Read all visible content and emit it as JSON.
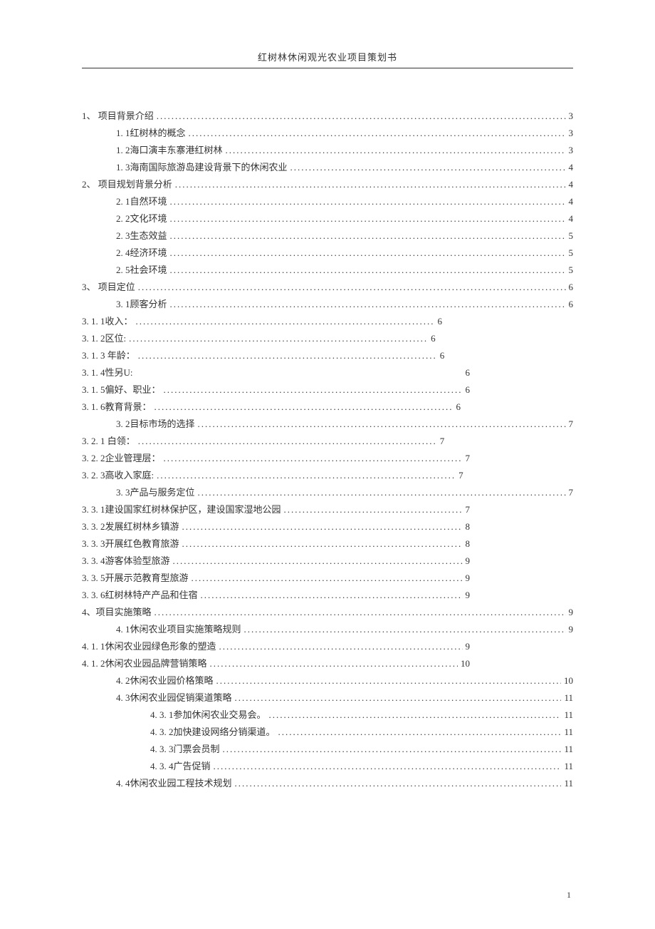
{
  "header": "红树林休闲观光农业项目策划书",
  "page_number": "1",
  "toc": [
    {
      "label": "1、  项目背景介绍",
      "page": "3",
      "indent": 0,
      "style": "full"
    },
    {
      "label": "1. 1红树林的概念",
      "page": "3",
      "indent": 1,
      "style": "full"
    },
    {
      "label": "1. 2海口演丰东寨港红树林  ",
      "page": " 3",
      "indent": 1,
      "style": "full"
    },
    {
      "label": "1. 3海南国际旅游岛建设背景下的休闲农业  ",
      "page": "4",
      "indent": 1,
      "style": "full"
    },
    {
      "label": "2、  项目规划背景分析  ",
      "page": "4",
      "indent": 0,
      "style": "full"
    },
    {
      "label": "2. 1自然环境 ",
      "page": "4",
      "indent": 1,
      "style": "full"
    },
    {
      "label": "2. 2文化环境 ",
      "page": "4",
      "indent": 1,
      "style": "full"
    },
    {
      "label": "2. 3生态效益 ",
      "page": "5",
      "indent": 1,
      "style": "full"
    },
    {
      "label": "2. 4经济环境 ",
      "page": "5",
      "indent": 1,
      "style": "full"
    },
    {
      "label": "2. 5社会环境 ",
      "page": "5",
      "indent": 1,
      "style": "full"
    },
    {
      "label": "3、  项目定位 ",
      "page": "6",
      "indent": 0,
      "style": "full"
    },
    {
      "label": "3. 1顾客分析 ",
      "page": "6",
      "indent": 1,
      "style": "full"
    },
    {
      "label": "3. 1. 1收入：",
      "page": "6",
      "indent": 0,
      "style": "short"
    },
    {
      "label": "3. 1. 2区位:",
      "page": "6",
      "indent": 0,
      "style": "short"
    },
    {
      "label": "3. 1. 3 年龄：",
      "page": "6",
      "indent": 0,
      "style": "short"
    },
    {
      "label": "3. 1. 4性另U:",
      "page": "6",
      "indent": 0,
      "style": "nodots"
    },
    {
      "label": "3. 1. 5偏好、职业：",
      "page": "6",
      "indent": 0,
      "style": "short"
    },
    {
      "label": "3. 1. 6教育背景：  ",
      "page": "6",
      "indent": 0,
      "style": "short"
    },
    {
      "label": "3. 2目标市场的选择 ",
      "page": "7",
      "indent": 1,
      "style": "full"
    },
    {
      "label": "3. 2. 1  白领：",
      "page": "7",
      "indent": 0,
      "style": "short"
    },
    {
      "label": "3. 2. 2企业管理层：",
      "page": "7",
      "indent": 0,
      "style": "short"
    },
    {
      "label": "3. 2. 3高收入家庭:",
      "page": " 7",
      "indent": 0,
      "style": "short"
    },
    {
      "label": "3. 3产品与服务定位 ",
      "page": "7",
      "indent": 1,
      "style": "full"
    },
    {
      "label": "3. 3. 1建设国家红树林保护区，建设国家湿地公园  ",
      "page": "7",
      "indent": 0,
      "style": "short"
    },
    {
      "label": "3. 3. 2发展红树林乡镇游  ",
      "page": "8",
      "indent": 0,
      "style": "short"
    },
    {
      "label": "3. 3. 3开展红色教育旅游  ",
      "page": " 8",
      "indent": 0,
      "style": "short"
    },
    {
      "label": "3. 3. 4游客体验型旅游  ",
      "page": " 9",
      "indent": 0,
      "style": "short"
    },
    {
      "label": "3. 3. 5开展示范教育型旅游  ",
      "page": "9",
      "indent": 0,
      "style": "short"
    },
    {
      "label": "3. 3. 6红树林特产产品和住宿  ",
      "page": "9",
      "indent": 0,
      "style": "short"
    },
    {
      "label": " 4、项目实施策略 ",
      "page": "9",
      "indent": 0,
      "style": "full"
    },
    {
      "label": "4. 1休闲农业项目实施策略规则  ",
      "page": " 9",
      "indent": 1,
      "style": "full"
    },
    {
      "label": "4. 1. 1休闲农业园绿色形象的塑造  ",
      "page": " 9",
      "indent": 0,
      "style": "short"
    },
    {
      "label": "4. 1. 2休闲农业园品牌营销策略  ",
      "page": "10",
      "indent": 0,
      "style": "short"
    },
    {
      "label": "4. 2休闲农业园价格策略  ",
      "page": "10",
      "indent": 1,
      "style": "full"
    },
    {
      "label": "4. 3休闲农业园促销渠道策略  ",
      "page": "11",
      "indent": 1,
      "style": "full"
    },
    {
      "label": "4. 3. 1参加休闲农业交易会。",
      "page": "11",
      "indent": 2,
      "style": "full"
    },
    {
      "label": "4. 3. 2加快建设网络分销渠道。",
      "page": "11",
      "indent": 2,
      "style": "full"
    },
    {
      "label": "4. 3. 3门票会员制 ",
      "page": "11",
      "indent": 2,
      "style": "full"
    },
    {
      "label": "4. 3. 4广告促销",
      "page": "11",
      "indent": 2,
      "style": "full"
    },
    {
      "label": "4. 4休闲农业园工程技术规划  ",
      "page": " 11",
      "indent": 1,
      "style": "full"
    }
  ]
}
